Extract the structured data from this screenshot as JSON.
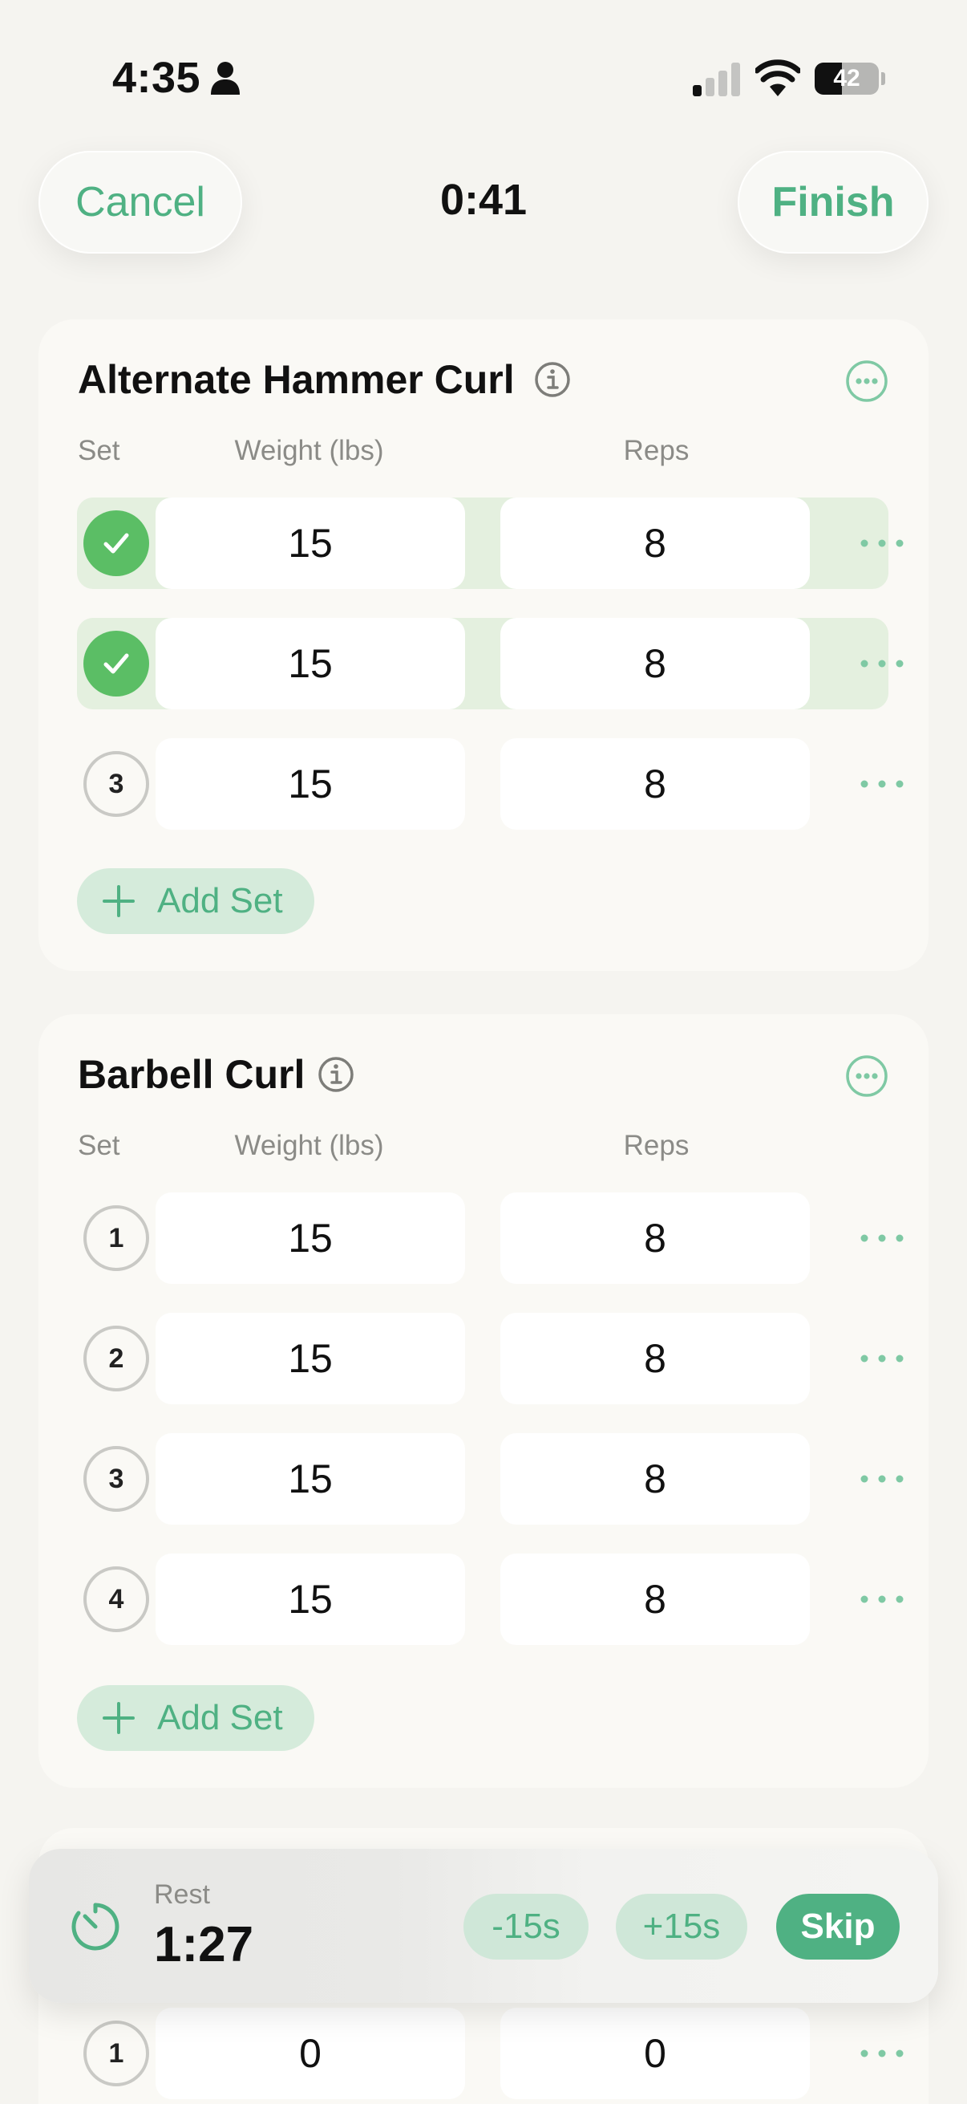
{
  "status_bar": {
    "time": "4:35",
    "battery_level": "42",
    "battery_fraction": 0.42,
    "signal_bars_active": 1,
    "signal_bars_total": 4
  },
  "header": {
    "cancel_label": "Cancel",
    "elapsed": "0:41",
    "finish_label": "Finish"
  },
  "colors": {
    "accent": "#4fb183",
    "done_green": "#5bbe65",
    "done_row": "#e4f0df",
    "chip_bg": "#d5ebdb",
    "background": "#f5f4f0"
  },
  "columns": {
    "set": "Set",
    "weight": "Weight (lbs)",
    "reps": "Reps"
  },
  "exercises": [
    {
      "name": "Alternate Hammer Curl",
      "sets": [
        {
          "number": "1",
          "weight": "15",
          "reps": "8",
          "done": true
        },
        {
          "number": "2",
          "weight": "15",
          "reps": "8",
          "done": true
        },
        {
          "number": "3",
          "weight": "15",
          "reps": "8",
          "done": false
        }
      ],
      "add_set_label": "Add Set"
    },
    {
      "name": "Barbell Curl",
      "sets": [
        {
          "number": "1",
          "weight": "15",
          "reps": "8",
          "done": false
        },
        {
          "number": "2",
          "weight": "15",
          "reps": "8",
          "done": false
        },
        {
          "number": "3",
          "weight": "15",
          "reps": "8",
          "done": false
        },
        {
          "number": "4",
          "weight": "15",
          "reps": "8",
          "done": false
        }
      ],
      "add_set_label": "Add Set"
    },
    {
      "name": "",
      "sets": [
        {
          "number": "1",
          "weight": "0",
          "reps": "0",
          "done": false
        }
      ]
    }
  ],
  "rest_timer": {
    "label": "Rest",
    "time": "1:27",
    "minus_label": "-15s",
    "plus_label": "+15s",
    "skip_label": "Skip"
  }
}
